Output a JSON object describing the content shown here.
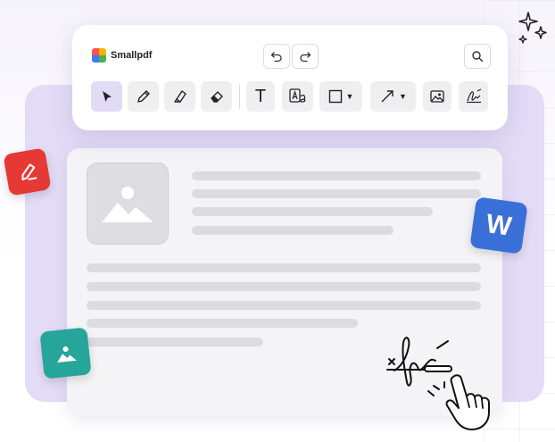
{
  "toolbar": {
    "brand": "Smallpdf",
    "logo_colors": [
      "#ff5252",
      "#ffb300",
      "#3d7bf4",
      "#4caf50"
    ],
    "undo_icon": "undo-icon",
    "redo_icon": "redo-icon",
    "search_icon": "search-icon",
    "tools": [
      {
        "name": "select",
        "icon": "cursor-icon",
        "active": true
      },
      {
        "name": "pencil",
        "icon": "pencil-icon"
      },
      {
        "name": "highlighter",
        "icon": "highlighter-icon"
      },
      {
        "name": "eraser",
        "icon": "eraser-icon"
      },
      {
        "name": "text",
        "icon": "text-icon",
        "glyph": "T"
      },
      {
        "name": "text-format",
        "icon": "text-format-icon"
      },
      {
        "name": "shape",
        "icon": "rectangle-icon",
        "dropdown": true
      },
      {
        "name": "arrow",
        "icon": "arrow-icon",
        "dropdown": true
      },
      {
        "name": "image",
        "icon": "image-icon"
      },
      {
        "name": "signature",
        "icon": "signature-icon"
      }
    ],
    "accent": "#e1dbf6"
  },
  "badges": {
    "edit": {
      "icon": "pen-edit-icon",
      "color": "#e53935"
    },
    "word": {
      "letter": "W",
      "color": "#3a6fd8"
    },
    "image": {
      "icon": "image-icon",
      "color": "#26a69a"
    }
  },
  "document": {
    "placeholder_icon": "image-placeholder-icon"
  }
}
